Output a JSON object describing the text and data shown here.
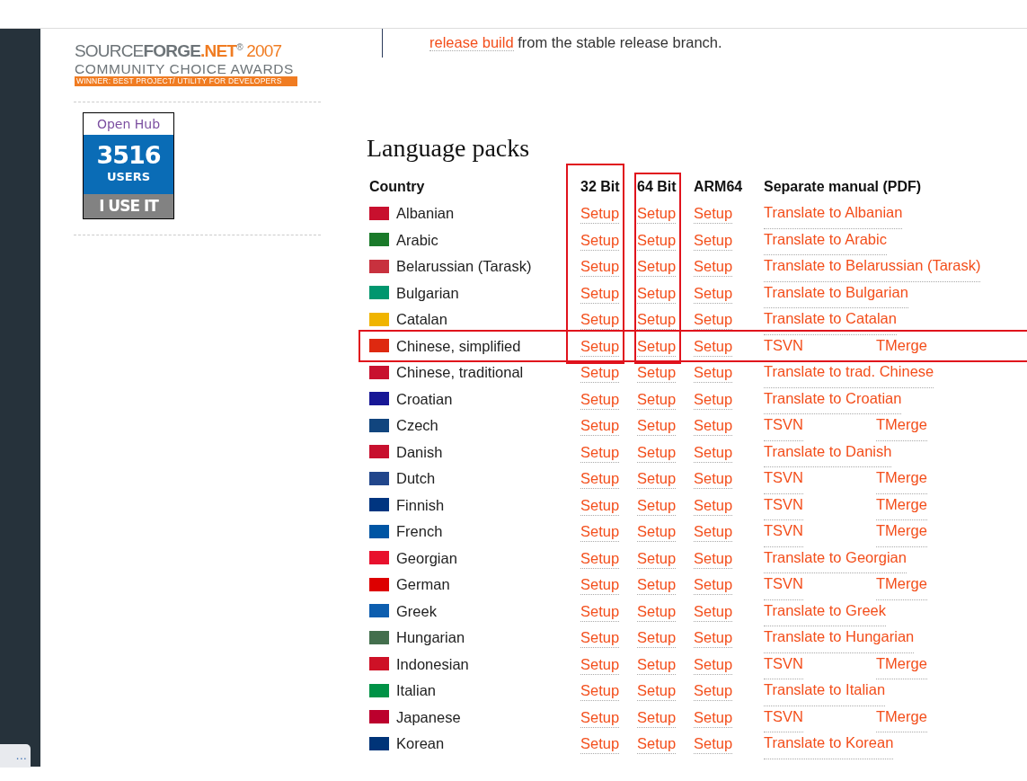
{
  "sidebar": {
    "award": {
      "line1_a": "SOURCE",
      "line1_b": "FORGE",
      "line1_c": ".NET",
      "line1_d": "®",
      "year": "2007",
      "line2": "COMMUNITY CHOICE AWARDS",
      "banner": "WINNER: BEST PROJECT/ UTILITY FOR DEVELOPERS"
    },
    "openhub": {
      "title": "Open Hub",
      "count": "3516",
      "unit": "USERS",
      "action": "I USE IT"
    },
    "tooltip": "..."
  },
  "intro": {
    "link": "release build",
    "text": " from the stable release branch."
  },
  "heading": "Language packs",
  "table": {
    "columns": [
      {
        "label": "Country"
      },
      {
        "label": "32 Bit",
        "highlighted": true
      },
      {
        "label": "64 Bit",
        "highlighted": true
      },
      {
        "label": "ARM64"
      },
      {
        "label": "Separate manual (PDF)"
      }
    ],
    "rows": [
      {
        "country": "Albanian",
        "color": "#c8102e",
        "setup": [
          "Setup",
          "Setup",
          "Setup"
        ],
        "manual": [
          "Translate to Albanian"
        ]
      },
      {
        "country": "Arabic",
        "color": "#1a7a2a",
        "setup": [
          "Setup",
          "Setup",
          "Setup"
        ],
        "manual": [
          "Translate to Arabic"
        ]
      },
      {
        "country": "Belarussian (Tarask)",
        "color": "#c8313e",
        "setup": [
          "Setup",
          "Setup",
          "Setup"
        ],
        "manual": [
          "Translate to Belarussian (Tarask)"
        ]
      },
      {
        "country": "Bulgarian",
        "color": "#00966e",
        "setup": [
          "Setup",
          "Setup",
          "Setup"
        ],
        "manual": [
          "Translate to Bulgarian"
        ]
      },
      {
        "country": "Catalan",
        "color": "#f0b400",
        "setup": [
          "Setup",
          "Setup",
          "Setup"
        ],
        "manual": [
          "Translate to Catalan"
        ]
      },
      {
        "country": "Chinese, simplified",
        "color": "#de2910",
        "setup": [
          "Setup",
          "Setup",
          "Setup"
        ],
        "manual": [
          "TSVN",
          "TMerge"
        ],
        "highlighted": true
      },
      {
        "country": "Chinese, traditional",
        "color": "#c8102e",
        "setup": [
          "Setup",
          "Setup",
          "Setup"
        ],
        "manual": [
          "Translate to trad. Chinese"
        ]
      },
      {
        "country": "Croatian",
        "color": "#171796",
        "setup": [
          "Setup",
          "Setup",
          "Setup"
        ],
        "manual": [
          "Translate to Croatian"
        ]
      },
      {
        "country": "Czech",
        "color": "#11457e",
        "setup": [
          "Setup",
          "Setup",
          "Setup"
        ],
        "manual": [
          "TSVN",
          "TMerge"
        ]
      },
      {
        "country": "Danish",
        "color": "#c8102e",
        "setup": [
          "Setup",
          "Setup",
          "Setup"
        ],
        "manual": [
          "Translate to Danish"
        ]
      },
      {
        "country": "Dutch",
        "color": "#21468b",
        "setup": [
          "Setup",
          "Setup",
          "Setup"
        ],
        "manual": [
          "TSVN",
          "TMerge"
        ]
      },
      {
        "country": "Finnish",
        "color": "#003580",
        "setup": [
          "Setup",
          "Setup",
          "Setup"
        ],
        "manual": [
          "TSVN",
          "TMerge"
        ]
      },
      {
        "country": "French",
        "color": "#0055a4",
        "setup": [
          "Setup",
          "Setup",
          "Setup"
        ],
        "manual": [
          "TSVN",
          "TMerge"
        ]
      },
      {
        "country": "Georgian",
        "color": "#e8112d",
        "setup": [
          "Setup",
          "Setup",
          "Setup"
        ],
        "manual": [
          "Translate to Georgian"
        ]
      },
      {
        "country": "German",
        "color": "#dd0000",
        "setup": [
          "Setup",
          "Setup",
          "Setup"
        ],
        "manual": [
          "TSVN",
          "TMerge"
        ]
      },
      {
        "country": "Greek",
        "color": "#0d5eaf",
        "setup": [
          "Setup",
          "Setup",
          "Setup"
        ],
        "manual": [
          "Translate to Greek"
        ]
      },
      {
        "country": "Hungarian",
        "color": "#436f4d",
        "setup": [
          "Setup",
          "Setup",
          "Setup"
        ],
        "manual": [
          "Translate to Hungarian"
        ]
      },
      {
        "country": "Indonesian",
        "color": "#ce1126",
        "setup": [
          "Setup",
          "Setup",
          "Setup"
        ],
        "manual": [
          "TSVN",
          "TMerge"
        ]
      },
      {
        "country": "Italian",
        "color": "#009246",
        "setup": [
          "Setup",
          "Setup",
          "Setup"
        ],
        "manual": [
          "Translate to Italian"
        ]
      },
      {
        "country": "Japanese",
        "color": "#bc002d",
        "setup": [
          "Setup",
          "Setup",
          "Setup"
        ],
        "manual": [
          "TSVN",
          "TMerge"
        ]
      },
      {
        "country": "Korean",
        "color": "#003478",
        "setup": [
          "Setup",
          "Setup",
          "Setup"
        ],
        "manual": [
          "Translate to Korean"
        ]
      }
    ]
  }
}
